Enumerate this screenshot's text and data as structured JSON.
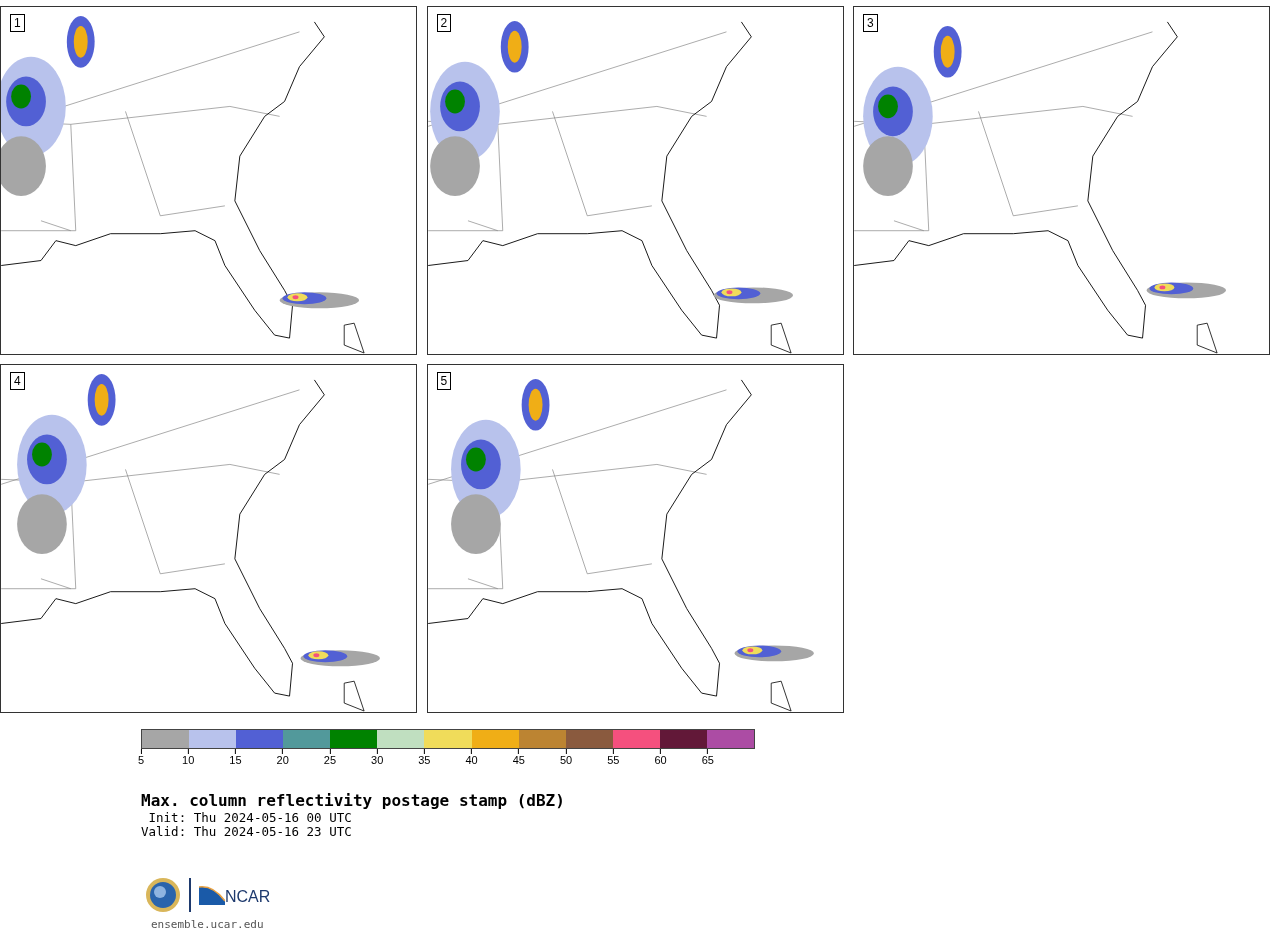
{
  "panels": [
    {
      "label": "1"
    },
    {
      "label": "2"
    },
    {
      "label": "3"
    },
    {
      "label": "4"
    },
    {
      "label": "5"
    }
  ],
  "colorbar": {
    "bins": [
      {
        "color": "#a6a6a6"
      },
      {
        "color": "#b8c2ec"
      },
      {
        "color": "#5260d4"
      },
      {
        "color": "#52999b"
      },
      {
        "color": "#008200"
      },
      {
        "color": "#c0dfc0"
      },
      {
        "color": "#f0dc5a"
      },
      {
        "color": "#f0ae16"
      },
      {
        "color": "#bc8432"
      },
      {
        "color": "#8a5a3e"
      },
      {
        "color": "#f5507e"
      },
      {
        "color": "#621838"
      },
      {
        "color": "#ac4ca4"
      }
    ],
    "ticks": [
      "5",
      "10",
      "15",
      "20",
      "25",
      "30",
      "35",
      "40",
      "45",
      "50",
      "55",
      "60",
      "65"
    ]
  },
  "title": "Max. column reflectivity postage stamp (dBZ)",
  "init": " Init: Thu 2024-05-16 00 UTC",
  "valid": "Valid: Thu 2024-05-16 23 UTC",
  "logo_text": "NCAR",
  "site": "ensemble.ucar.edu"
}
